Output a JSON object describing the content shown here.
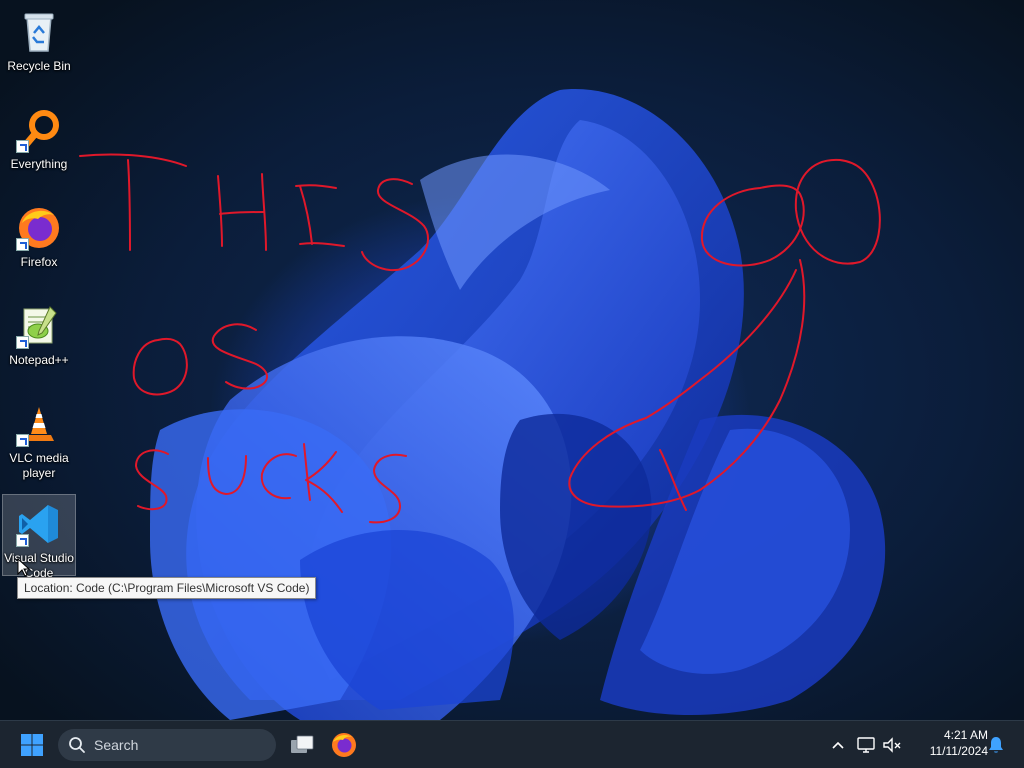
{
  "desktop": {
    "icons": [
      {
        "label": "Recycle Bin",
        "icon": "recycle-bin-icon"
      },
      {
        "label": "Everything",
        "icon": "everything-search-icon"
      },
      {
        "label": "Firefox",
        "icon": "firefox-icon"
      },
      {
        "label": "Notepad++",
        "icon": "notepad-plus-plus-icon"
      },
      {
        "label": "VLC media player",
        "icon": "vlc-cone-icon"
      },
      {
        "label": "Visual Studio Code",
        "icon": "vscode-icon"
      }
    ],
    "tooltip": "Location: Code (C:\\Program Files\\Microsoft VS Code)",
    "wallpaper": "windows-11-bloom",
    "accent": "#1f4fe0",
    "scribble_color": "#e0182a"
  },
  "taskbar": {
    "search_placeholder": "Search",
    "time": "4:21 AM",
    "date": "11/11/2024",
    "pinned": [
      "windows-start-icon",
      "search-icon",
      "task-view-icon",
      "firefox-icon"
    ],
    "tray": [
      "chevron-up-icon",
      "network-icon",
      "speaker-muted-icon",
      "notification-bell-icon"
    ]
  }
}
